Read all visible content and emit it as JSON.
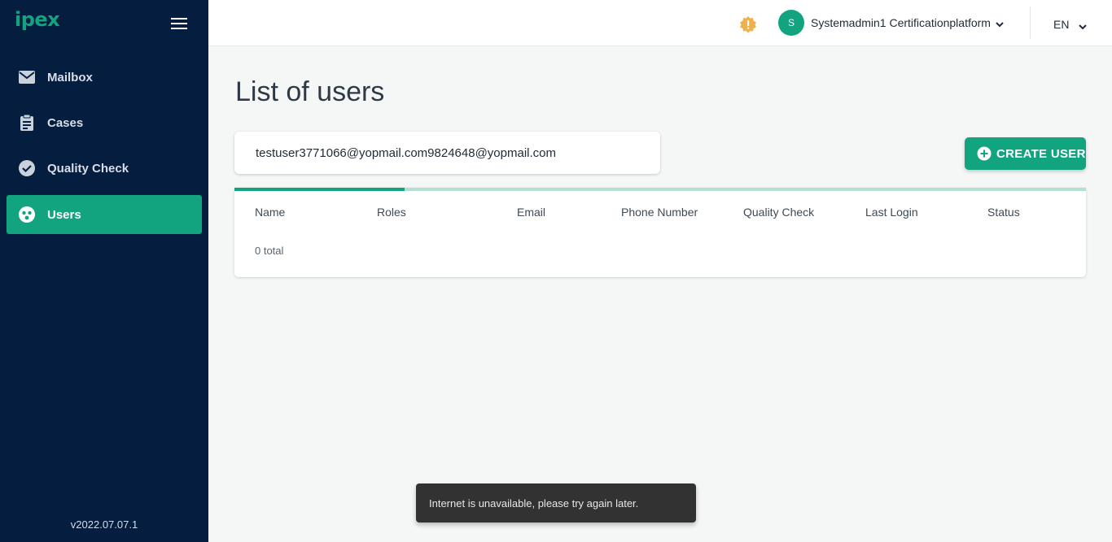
{
  "app": {
    "logo": "ipex",
    "version": "v2022.07.07.1"
  },
  "sidebar": {
    "items": [
      {
        "label": "Mailbox",
        "icon": "mail-icon"
      },
      {
        "label": "Cases",
        "icon": "clipboard-icon"
      },
      {
        "label": "Quality Check",
        "icon": "check-circle-icon"
      },
      {
        "label": "Users",
        "icon": "users-icon",
        "active": true
      }
    ]
  },
  "header": {
    "avatar_initial": "S",
    "username": "Systemadmin1 Certificationplatform",
    "language": "EN"
  },
  "main": {
    "title": "List of users",
    "search": {
      "value": "testuser3771066@yopmail.com9824648@yopmail.com"
    },
    "create_button": "CREATE USER",
    "table": {
      "columns": [
        "Name",
        "Roles",
        "Email",
        "Phone Number",
        "Quality Check",
        "Last Login",
        "Status"
      ],
      "total_text": "0 total",
      "loading_progress": 0.2
    }
  },
  "toast": {
    "message": "Internet is unavailable, please try again later."
  },
  "colors": {
    "accent": "#12a37f",
    "sidebar_bg": "#051d3f",
    "warning": "#f0b04c"
  }
}
